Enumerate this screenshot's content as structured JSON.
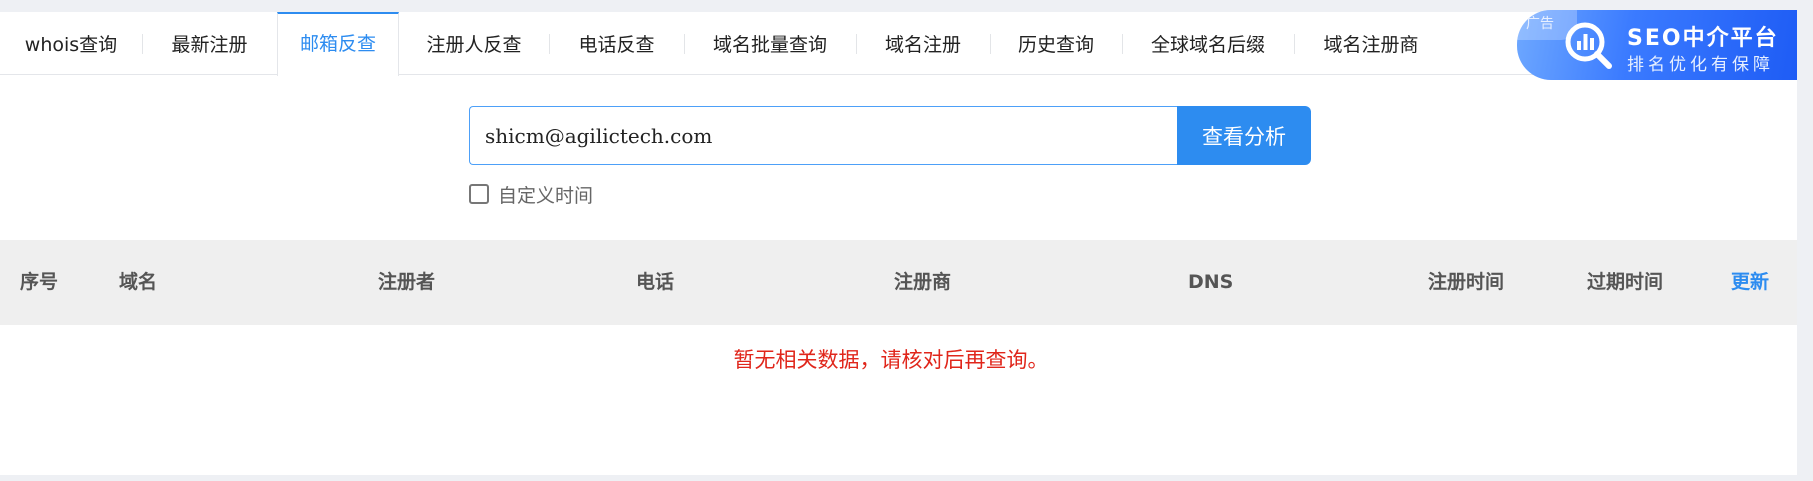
{
  "tabs": [
    {
      "label": "whois查询"
    },
    {
      "label": "最新注册"
    },
    {
      "label": "邮箱反查",
      "active": true
    },
    {
      "label": "注册人反查"
    },
    {
      "label": "电话反查"
    },
    {
      "label": "域名批量查询"
    },
    {
      "label": "域名注册"
    },
    {
      "label": "历史查询"
    },
    {
      "label": "全球域名后缀"
    },
    {
      "label": "域名注册商"
    }
  ],
  "ad": {
    "tag": "广告",
    "title": "SEO中介平台",
    "subtitle": "排名优化有保障",
    "logo_icon": "chart-magnifier-icon"
  },
  "search": {
    "value": "shicm@agilictech.com",
    "button_label": "查看分析",
    "custom_time_label": "自定义时间",
    "custom_time_checked": false
  },
  "table": {
    "columns": [
      "序号",
      "域名",
      "注册者",
      "电话",
      "注册商",
      "DNS",
      "注册时间",
      "过期时间"
    ],
    "refresh_label": "更新",
    "empty_message": "暂无相关数据，请核对后再查询。",
    "rows": []
  },
  "colors": {
    "accent": "#2d8cf0",
    "empty_text": "#e0261b",
    "header_bg": "#efefef"
  }
}
